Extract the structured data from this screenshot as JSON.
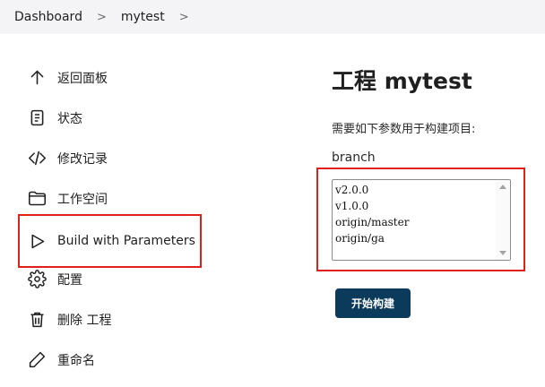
{
  "breadcrumb": {
    "items": [
      "Dashboard",
      "mytest"
    ],
    "separator": ">"
  },
  "sidebar": {
    "items": [
      {
        "label": "返回面板",
        "icon": "arrow-up-icon"
      },
      {
        "label": "状态",
        "icon": "document-icon"
      },
      {
        "label": "修改记录",
        "icon": "code-icon"
      },
      {
        "label": "工作空间",
        "icon": "folder-icon"
      },
      {
        "label": "Build with Parameters",
        "icon": "play-icon"
      },
      {
        "label": "配置",
        "icon": "gear-icon"
      },
      {
        "label": "删除 工程",
        "icon": "trash-icon"
      },
      {
        "label": "重命名",
        "icon": "pencil-icon"
      }
    ]
  },
  "main": {
    "title": "工程 mytest",
    "description": "需要如下参数用于构建项目:",
    "parameter": {
      "name": "branch",
      "options": [
        "v2.0.0",
        "v1.0.0",
        "origin/master",
        "origin/ga"
      ]
    },
    "build_button": "开始构建"
  },
  "colors": {
    "highlight": "#e0201b",
    "button": "#0b3a5a",
    "breadcrumb_bg": "#f4f4f6"
  }
}
